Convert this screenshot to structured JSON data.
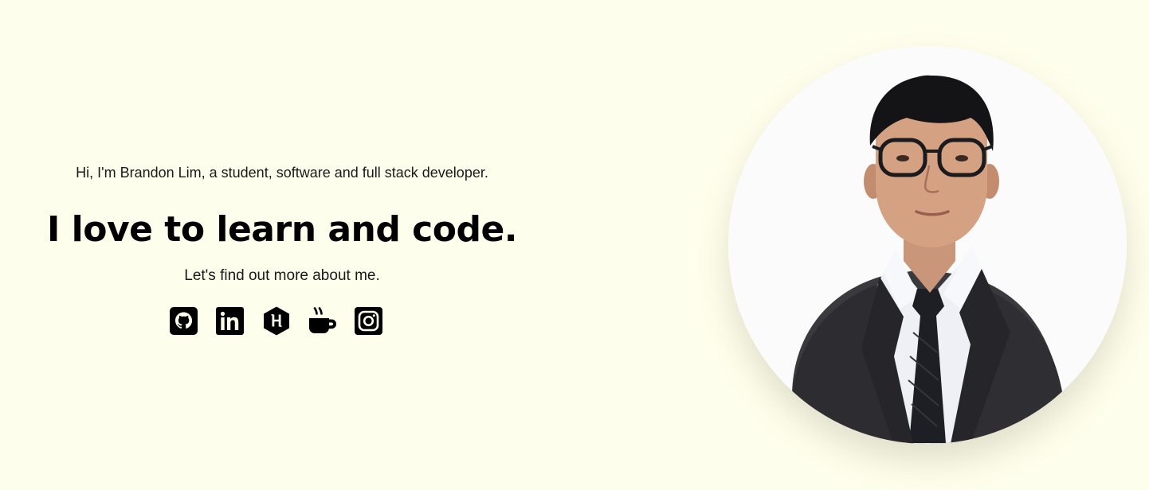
{
  "hero": {
    "greeting": "Hi, I'm Brandon Lim, a student, software and full stack developer.",
    "headline": "I love to learn and code.",
    "subheading": "Let's find out more about me."
  },
  "socials": [
    {
      "name": "GitHub",
      "icon": "github-icon"
    },
    {
      "name": "LinkedIn",
      "icon": "linkedin-icon"
    },
    {
      "name": "HackerRank",
      "icon": "hackerrank-icon"
    },
    {
      "name": "Ko-fi",
      "icon": "coffee-icon"
    },
    {
      "name": "Instagram",
      "icon": "instagram-icon"
    }
  ],
  "portrait": {
    "icon": "profile-photo"
  },
  "colors": {
    "background": "#fefeec",
    "text": "#111111",
    "icon": "#000000"
  }
}
